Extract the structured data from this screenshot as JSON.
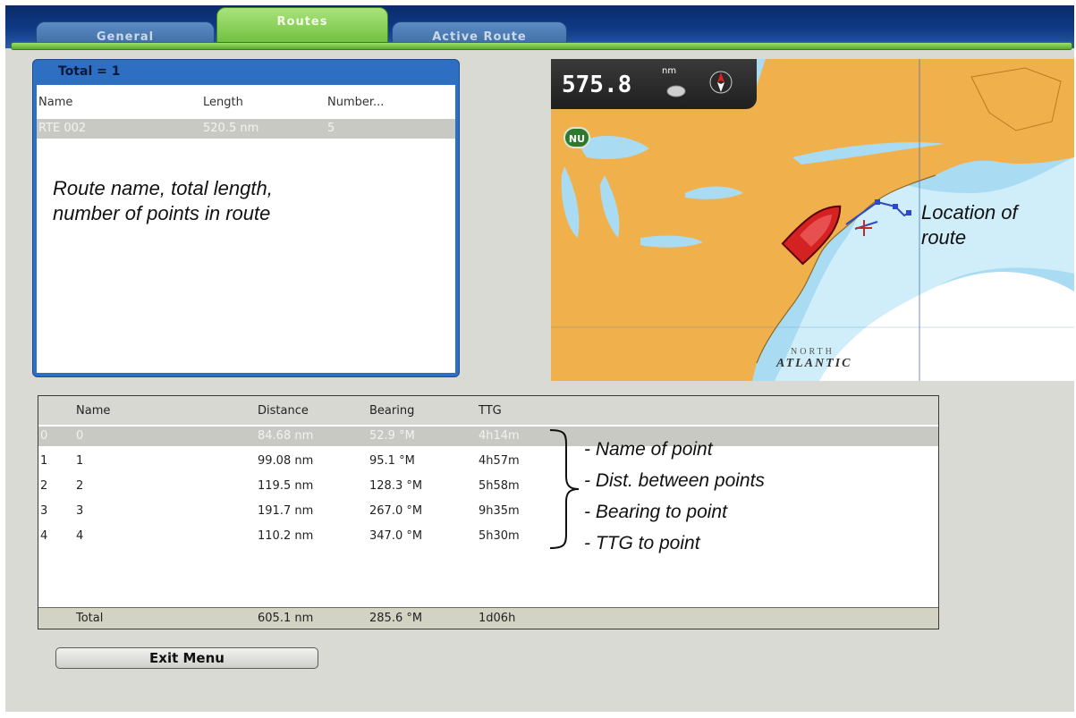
{
  "tabs": [
    {
      "label": "General"
    },
    {
      "label": "Routes"
    },
    {
      "label": "Active Route"
    }
  ],
  "route_panel": {
    "total": "Total = 1",
    "columns": [
      "Name",
      "Length",
      "Number..."
    ],
    "rows": [
      {
        "name": "RTE 002",
        "length": "520.5 nm",
        "number": "5"
      }
    ],
    "annotation": [
      "Route name, total length,",
      "number of points in route"
    ]
  },
  "map": {
    "scale_value": "575.8",
    "scale_unit": "nm",
    "badge": "NU",
    "ocean_label": "NORTH",
    "ocean_label2": "ATLANTIC",
    "annotation": [
      "Location of",
      "route"
    ],
    "colors": {
      "land": "#f0b14c",
      "shallow": "#9fd8f2",
      "deep": "#ffffff",
      "route": "#2d48c8",
      "boat": "#d42222"
    }
  },
  "waypoints": {
    "columns": [
      "Name",
      "Distance",
      "Bearing",
      "TTG"
    ],
    "rows": [
      {
        "index": "0",
        "name": "0",
        "distance": "84.68 nm",
        "bearing": "52.9 °M",
        "ttg": "4h14m"
      },
      {
        "index": "1",
        "name": "1",
        "distance": "99.08 nm",
        "bearing": "95.1 °M",
        "ttg": "4h57m"
      },
      {
        "index": "2",
        "name": "2",
        "distance": "119.5 nm",
        "bearing": "128.3 °M",
        "ttg": "5h58m"
      },
      {
        "index": "3",
        "name": "3",
        "distance": "191.7 nm",
        "bearing": "267.0 °M",
        "ttg": "9h35m"
      },
      {
        "index": "4",
        "name": "4",
        "distance": "110.2 nm",
        "bearing": "347.0 °M",
        "ttg": "5h30m"
      }
    ],
    "total": {
      "label": "Total",
      "distance": "605.1 nm",
      "bearing": "285.6 °M",
      "ttg": "1d06h"
    },
    "annotations": [
      "- Name of point",
      "- Dist. between points",
      "- Bearing to point",
      "- TTG to point"
    ]
  },
  "exit_button": "Exit Menu"
}
